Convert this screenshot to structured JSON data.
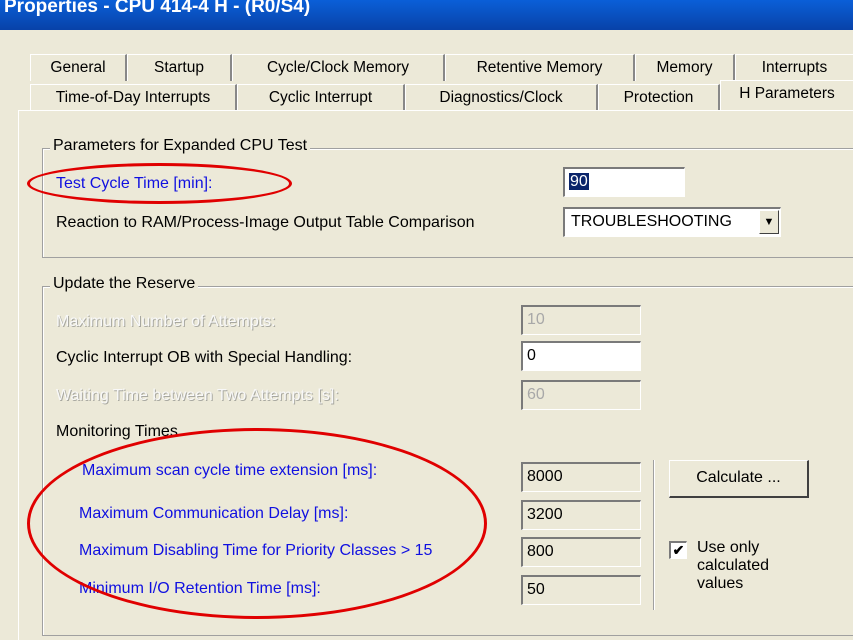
{
  "window": {
    "title": "Properties - CPU 414-4 H - (R0/S4)"
  },
  "tabs_row1": [
    "General",
    "Startup",
    "Cycle/Clock Memory",
    "Retentive Memory",
    "Memory",
    "Interrupts"
  ],
  "tabs_row2": [
    "Time-of-Day Interrupts",
    "Cyclic Interrupt",
    "Diagnostics/Clock",
    "Protection",
    "H Parameters"
  ],
  "cpu_test": {
    "legend": "Parameters for Expanded CPU Test",
    "test_cycle_label": "Test Cycle Time [min]:",
    "test_cycle_value": "90",
    "reaction_label": "Reaction to RAM/Process-Image Output Table Comparison",
    "reaction_value": "TROUBLESHOOTING"
  },
  "reserve": {
    "legend": "Update the Reserve",
    "max_attempts_label": "Maximum Number of Attempts:",
    "max_attempts_value": "10",
    "cyclic_ob_label": "Cyclic Interrupt OB with Special Handling:",
    "cyclic_ob_value": "0",
    "wait_time_label": "Waiting Time between Two Attempts [s]:",
    "wait_time_value": "60",
    "monitoring_label": "Monitoring Times",
    "scan_ext_label": "Maximum scan cycle time extension [ms]:",
    "scan_ext_value": "8000",
    "comm_delay_label": "Maximum Communication Delay [ms]:",
    "comm_delay_value": "3200",
    "disable_time_label": "Maximum Disabling Time for Priority Classes > 15",
    "disable_time_value": "800",
    "io_retention_label": "Minimum I/O Retention Time [ms]:",
    "io_retention_value": "50",
    "calculate_label": "Calculate ...",
    "use_calc_label": "Use only calculated values",
    "use_calc_checked": "✔"
  },
  "colors": {
    "annotation": "#E00000",
    "label_blue": "#1010E0",
    "title_bar": "#0A5FD8"
  }
}
